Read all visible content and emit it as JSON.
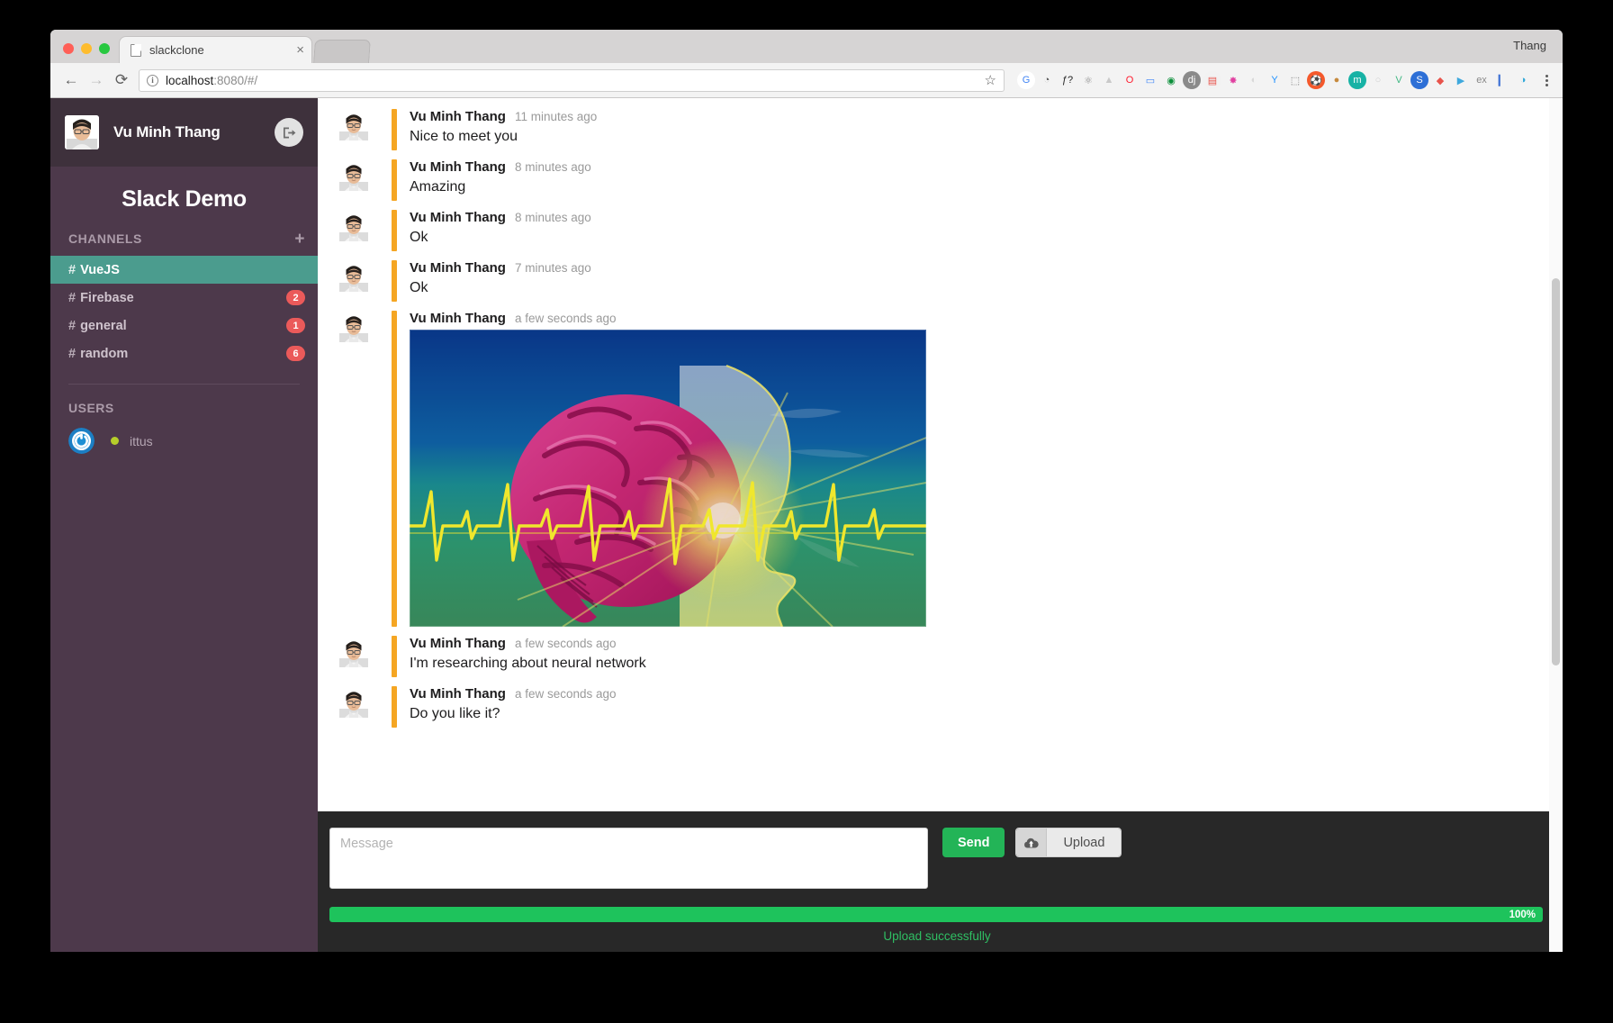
{
  "browser": {
    "tab_title": "slackclone",
    "tab_close_glyph": "×",
    "profile_name": "Thang",
    "back_glyph": "←",
    "forward_glyph": "→",
    "reload_glyph": "⟳",
    "info_glyph": "i",
    "url_host": "localhost",
    "url_path": ":8080/#/",
    "star_glyph": "☆",
    "extensions": [
      {
        "name": "google-translate-icon",
        "glyph": "G",
        "color": "#4285f4",
        "bg": "#ffffff"
      },
      {
        "name": "session-buddy-icon",
        "glyph": "◔",
        "color": "#555555",
        "bg": "transparent"
      },
      {
        "name": "fonts-ninja-icon",
        "glyph": "ƒ?",
        "color": "#222222",
        "bg": "transparent"
      },
      {
        "name": "react-devtools-icon",
        "glyph": "⚛",
        "color": "#8a8a8a",
        "bg": "transparent"
      },
      {
        "name": "drive-icon",
        "glyph": "▲",
        "color": "#c9c9c9",
        "bg": "transparent"
      },
      {
        "name": "opera-icon",
        "glyph": "O",
        "color": "#ff1b2d",
        "bg": "transparent"
      },
      {
        "name": "window-resizer-icon",
        "glyph": "▭",
        "color": "#3b82f6",
        "bg": "transparent"
      },
      {
        "name": "colorzilla-icon",
        "glyph": "◉",
        "color": "#0b8f3a",
        "bg": "transparent"
      },
      {
        "name": "django-icon",
        "glyph": "dj",
        "color": "#ffffff",
        "bg": "#8a8a8a"
      },
      {
        "name": "notes-icon",
        "glyph": "▤",
        "color": "#e8534b",
        "bg": "#f2f2f2"
      },
      {
        "name": "color-picker-icon",
        "glyph": "✸",
        "color": "#e040a0",
        "bg": "transparent"
      },
      {
        "name": "moon-icon",
        "glyph": "◐",
        "color": "#d8d8d8",
        "bg": "transparent"
      },
      {
        "name": "vysor-icon",
        "glyph": "Y",
        "color": "#1e90ff",
        "bg": "transparent"
      },
      {
        "name": "cast-icon",
        "glyph": "⬚",
        "color": "#777777",
        "bg": "transparent"
      },
      {
        "name": "soccer-icon",
        "glyph": "⚽",
        "color": "#ffffff",
        "bg": "#f4592c"
      },
      {
        "name": "cookie-icon",
        "glyph": "●",
        "color": "#c68a3e",
        "bg": "transparent"
      },
      {
        "name": "momentum-icon",
        "glyph": "m",
        "color": "#ffffff",
        "bg": "#17b2a5"
      },
      {
        "name": "ghost-icon",
        "glyph": "○",
        "color": "#cfcfcf",
        "bg": "transparent"
      },
      {
        "name": "vue-devtools-icon",
        "glyph": "V",
        "color": "#41b883",
        "bg": "transparent"
      },
      {
        "name": "stylish-icon",
        "glyph": "S",
        "color": "#ffffff",
        "bg": "#2d6fd6"
      },
      {
        "name": "wappalyzer-icon",
        "glyph": "◆",
        "color": "#e8534b",
        "bg": "transparent"
      },
      {
        "name": "screencastify-icon",
        "glyph": "▶",
        "color": "#3ea8dd",
        "bg": "transparent"
      },
      {
        "name": "exify-icon",
        "glyph": "ex",
        "color": "#888888",
        "bg": "transparent"
      },
      {
        "name": "fullpage-icon",
        "glyph": "▎",
        "color": "#3b6fd4",
        "bg": "transparent"
      },
      {
        "name": "ghostery-icon",
        "glyph": "◑",
        "color": "#2fa8d8",
        "bg": "transparent"
      }
    ]
  },
  "sidebar": {
    "user_name": "Vu Minh Thang",
    "logout_label": "logout",
    "team_title": "Slack Demo",
    "channels_heading": "CHANNELS",
    "add_channel_glyph": "+",
    "channels": [
      {
        "name": "VueJS",
        "hash": "#",
        "badge": "",
        "active": true
      },
      {
        "name": "Firebase",
        "hash": "#",
        "badge": "2",
        "active": false
      },
      {
        "name": "general",
        "hash": "#",
        "badge": "1",
        "active": false
      },
      {
        "name": "random",
        "hash": "#",
        "badge": "6",
        "active": false
      }
    ],
    "users_heading": "USERS",
    "users": [
      {
        "name": "ittus",
        "status": "online"
      }
    ]
  },
  "messages": [
    {
      "author": "Vu Minh Thang",
      "time": "11 minutes ago",
      "text": "Nice to meet you",
      "type": "text"
    },
    {
      "author": "Vu Minh Thang",
      "time": "8 minutes ago",
      "text": "Amazing",
      "type": "text"
    },
    {
      "author": "Vu Minh Thang",
      "time": "8 minutes ago",
      "text": "Ok",
      "type": "text"
    },
    {
      "author": "Vu Minh Thang",
      "time": "7 minutes ago",
      "text": "Ok",
      "type": "text"
    },
    {
      "author": "Vu Minh Thang",
      "time": "a few seconds ago",
      "text": "",
      "type": "image",
      "image_alt": "brain-ecg-illustration"
    },
    {
      "author": "Vu Minh Thang",
      "time": "a few seconds ago",
      "text": "I'm researching about neural network",
      "type": "text"
    },
    {
      "author": "Vu Minh Thang",
      "time": "a few seconds ago",
      "text": "Do you like it?",
      "type": "text"
    }
  ],
  "composer": {
    "placeholder": "Message",
    "input_value": "",
    "send_label": "Send",
    "upload_label": "Upload",
    "progress_percent": "100%",
    "progress_value": 100,
    "upload_status": "Upload successfully"
  },
  "colors": {
    "sidebar_bg": "#4d394b",
    "sidebar_head_bg": "#3e313c",
    "active_channel": "#4b9c8e",
    "badge": "#eb5a5a",
    "accent_bar": "#f5a623",
    "send_green": "#23b457",
    "progress_green": "#1ec35c",
    "status_green": "#2fbf63",
    "composer_bg": "#282828",
    "presence_online": "#b6ce2a"
  }
}
